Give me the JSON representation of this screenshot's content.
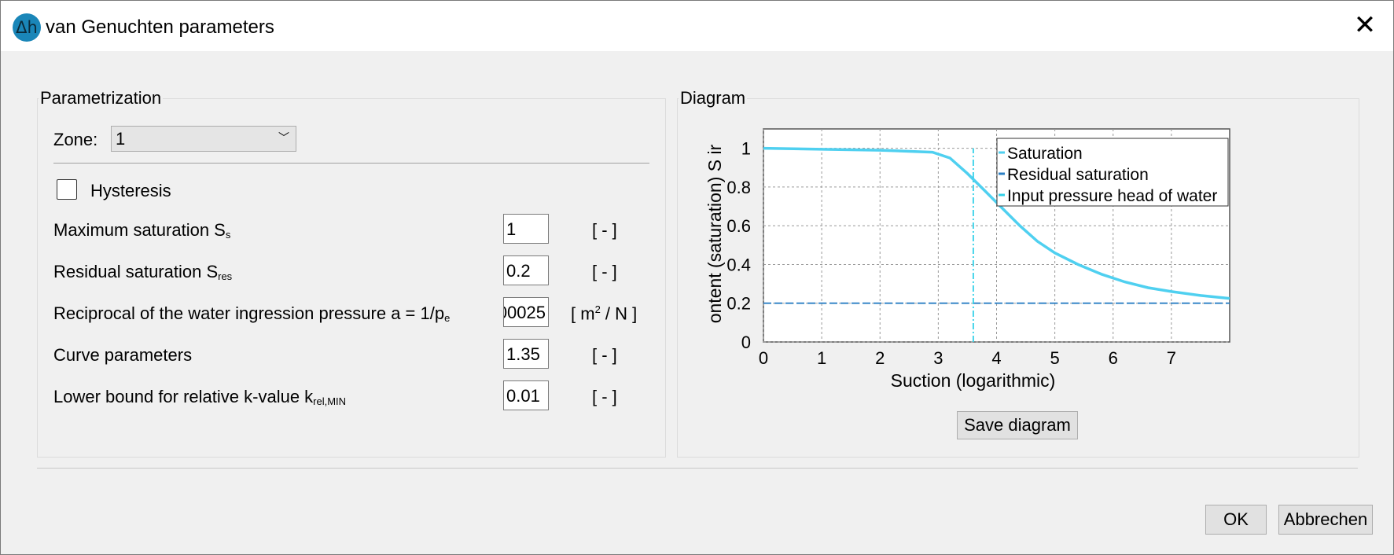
{
  "window": {
    "title": "van Genuchten parameters",
    "app_icon": "delta-h-icon"
  },
  "parametrization": {
    "group_title": "Parametrization",
    "zone_label": "Zone:",
    "zone_value": "1",
    "hysteresis_label": "Hysteresis",
    "hysteresis_checked": false,
    "rows": [
      {
        "label": "Maximum saturation S",
        "sub": "s",
        "value": "1",
        "unit": "[ - ]"
      },
      {
        "label": "Residual saturation S",
        "sub": "res",
        "value": "0.2",
        "unit": "[ - ]"
      },
      {
        "label": "Reciprocal of the water ingression pressure a = 1/p",
        "sub": "e",
        "value": "00025",
        "unit_pre": "[ m",
        "unit_sup": "2",
        "unit_post": " / N ]"
      },
      {
        "label": "Curve parameters",
        "sub": "",
        "value": "1.35",
        "unit": "[ - ]"
      },
      {
        "label": "Lower bound for relative k-value k",
        "sub": "rel,MIN",
        "value": "0.01",
        "unit": "[ - ]"
      }
    ]
  },
  "diagram": {
    "group_title": "Diagram",
    "save_button": "Save diagram"
  },
  "footer": {
    "ok": "OK",
    "cancel": "Abbrechen"
  },
  "chart_data": {
    "type": "line",
    "xlabel": "Suction (logarithmic)",
    "ylabel": "ontent (saturation) S ir",
    "xlim": [
      0,
      8
    ],
    "ylim": [
      0,
      1.1
    ],
    "xticks": [
      "0",
      "1",
      "2",
      "3",
      "4",
      "5",
      "6",
      "7"
    ],
    "yticks": [
      "0",
      "0.2",
      "0.4",
      "0.6",
      "0.8",
      "1"
    ],
    "grid": true,
    "legend_position": "top-right",
    "series": [
      {
        "name": "Saturation",
        "color": "#4fd0f0",
        "style": "solid",
        "x": [
          0,
          1,
          2,
          2.9,
          3.2,
          3.5,
          3.8,
          4.1,
          4.4,
          4.7,
          5.0,
          5.4,
          5.8,
          6.2,
          6.6,
          7.0,
          7.5,
          8.0
        ],
        "y": [
          1.0,
          0.995,
          0.99,
          0.98,
          0.95,
          0.87,
          0.78,
          0.69,
          0.6,
          0.52,
          0.46,
          0.4,
          0.35,
          0.31,
          0.28,
          0.26,
          0.24,
          0.225
        ]
      },
      {
        "name": "Residual saturation",
        "color": "#2b7fc4",
        "style": "dashed",
        "x": [
          0,
          8
        ],
        "y": [
          0.2,
          0.2
        ]
      },
      {
        "name": "Input pressure head of water",
        "color": "#33d0e8",
        "style": "dashdot",
        "x": [
          3.6,
          3.6
        ],
        "y": [
          0,
          1.0
        ]
      }
    ]
  }
}
